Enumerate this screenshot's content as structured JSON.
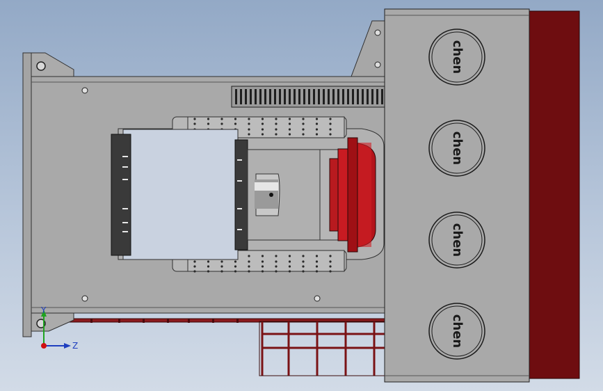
{
  "viewport": {
    "background_top": "#93a9c6",
    "background_bottom": "#d2dbe7"
  },
  "model": {
    "steel_color": "#a9a9a9",
    "steel_dark": "#8e8e8e",
    "red_color": "#c3131b",
    "dark_red": "#6e0d10",
    "logo_text": "chen",
    "logo_count": 4
  },
  "triad": {
    "y_label": "Y",
    "z_label": "Z",
    "y_color": "#1fa31f",
    "z_color": "#1f3fbf",
    "origin_color": "#d01010"
  }
}
